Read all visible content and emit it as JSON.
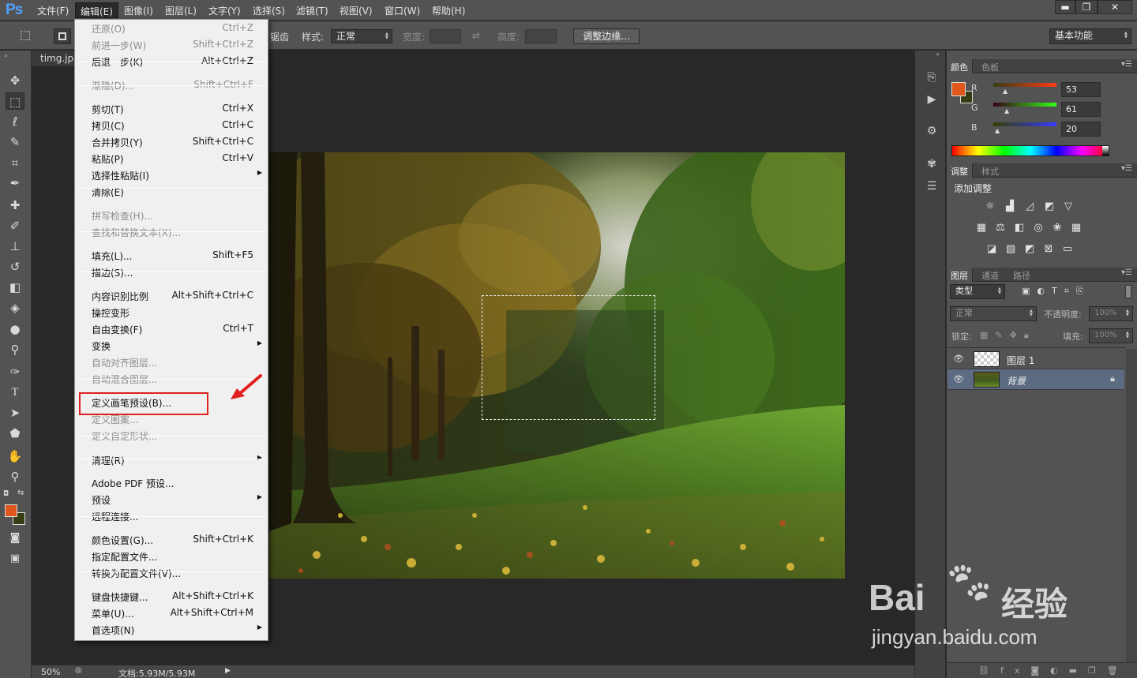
{
  "app": {
    "logo": "Ps"
  },
  "menubar": {
    "items": [
      "文件(F)",
      "编辑(E)",
      "图像(I)",
      "图层(L)",
      "文字(Y)",
      "选择(S)",
      "滤镜(T)",
      "视图(V)",
      "窗口(W)",
      "帮助(H)"
    ],
    "active_index": 1
  },
  "window_controls": {
    "minimize": "▬",
    "restore": "❐",
    "close": "✕"
  },
  "options_bar": {
    "feather_suffix": "锯齿",
    "style_label": "样式:",
    "style_value": "正常",
    "width_label": "宽度:",
    "height_label": "高度:",
    "refine_button": "调整边缘...",
    "workspace": "基本功能"
  },
  "document": {
    "tab": "timg.jpg",
    "zoom": "50%",
    "doc_info": "文档:5.93M/5.93M"
  },
  "edit_menu": {
    "items": [
      {
        "label": "还原(O)",
        "shortcut": "Ctrl+Z",
        "disabled": true
      },
      {
        "label": "前进一步(W)",
        "shortcut": "Shift+Ctrl+Z",
        "disabled": true
      },
      {
        "label": "后退一步(K)",
        "shortcut": "Alt+Ctrl+Z",
        "disabled": false
      },
      {
        "label": "渐隐(D)...",
        "shortcut": "Shift+Ctrl+F",
        "disabled": true
      },
      {
        "label": "剪切(T)",
        "shortcut": "Ctrl+X",
        "disabled": false
      },
      {
        "label": "拷贝(C)",
        "shortcut": "Ctrl+C",
        "disabled": false
      },
      {
        "label": "合并拷贝(Y)",
        "shortcut": "Shift+Ctrl+C",
        "disabled": false
      },
      {
        "label": "粘贴(P)",
        "shortcut": "Ctrl+V",
        "disabled": false
      },
      {
        "label": "选择性粘贴(I)",
        "shortcut": "",
        "submenu": true,
        "disabled": false
      },
      {
        "label": "清除(E)",
        "shortcut": "",
        "disabled": false
      },
      {
        "label": "拼写检查(H)...",
        "shortcut": "",
        "disabled": true
      },
      {
        "label": "查找和替换文本(X)...",
        "shortcut": "",
        "disabled": true
      },
      {
        "label": "填充(L)...",
        "shortcut": "Shift+F5",
        "disabled": false
      },
      {
        "label": "描边(S)...",
        "shortcut": "",
        "disabled": false
      },
      {
        "label": "内容识别比例",
        "shortcut": "Alt+Shift+Ctrl+C",
        "disabled": false
      },
      {
        "label": "操控变形",
        "shortcut": "",
        "disabled": false
      },
      {
        "label": "自由变换(F)",
        "shortcut": "Ctrl+T",
        "disabled": false
      },
      {
        "label": "变换",
        "shortcut": "",
        "submenu": true,
        "disabled": false
      },
      {
        "label": "自动对齐图层...",
        "shortcut": "",
        "disabled": true
      },
      {
        "label": "自动混合图层...",
        "shortcut": "",
        "disabled": true
      },
      {
        "label": "定义画笔预设(B)...",
        "shortcut": "",
        "disabled": false,
        "highlighted": true
      },
      {
        "label": "定义图案...",
        "shortcut": "",
        "disabled": true
      },
      {
        "label": "定义自定形状...",
        "shortcut": "",
        "disabled": true
      },
      {
        "label": "清理(R)",
        "shortcut": "",
        "submenu": true,
        "disabled": false
      },
      {
        "label": "Adobe PDF 预设...",
        "shortcut": "",
        "disabled": false
      },
      {
        "label": "预设",
        "shortcut": "",
        "submenu": true,
        "disabled": false
      },
      {
        "label": "远程连接...",
        "shortcut": "",
        "disabled": false
      },
      {
        "label": "颜色设置(G)...",
        "shortcut": "Shift+Ctrl+K",
        "disabled": false
      },
      {
        "label": "指定配置文件...",
        "shortcut": "",
        "disabled": false
      },
      {
        "label": "转换为配置文件(V)...",
        "shortcut": "",
        "disabled": false
      },
      {
        "label": "键盘快捷键...",
        "shortcut": "Alt+Shift+Ctrl+K",
        "disabled": false
      },
      {
        "label": "菜单(U)...",
        "shortcut": "Alt+Shift+Ctrl+M",
        "disabled": false
      },
      {
        "label": "首选项(N)",
        "shortcut": "",
        "submenu": true,
        "disabled": false
      }
    ]
  },
  "color_panel": {
    "tabs": [
      "颜色",
      "色板"
    ],
    "r_label": "R",
    "g_label": "G",
    "b_label": "B",
    "r": "53",
    "g": "61",
    "b": "20",
    "foreground": "#e0571b",
    "background": "#353d14"
  },
  "adjust_panel": {
    "tabs": [
      "调整",
      "样式"
    ],
    "title": "添加调整"
  },
  "layers_panel": {
    "tabs": [
      "图层",
      "通道",
      "路径"
    ],
    "filter_kind": "类型",
    "blend_mode": "正常",
    "opacity_label": "不透明度:",
    "opacity_value": "100%",
    "lock_label": "锁定:",
    "fill_label": "填充:",
    "fill_value": "100%",
    "layers": [
      {
        "name": "图层 1",
        "selected": false
      },
      {
        "name": "背景",
        "selected": true,
        "locked": true
      }
    ]
  },
  "watermark": {
    "brand": "Bai",
    "brand_cn": "经验",
    "url": "jingyan.baidu.com"
  },
  "colors": {
    "ui_dark": "#535353",
    "canvas_bg": "#282828",
    "accent_red": "#e02020",
    "ps_blue": "#4fa3ff"
  }
}
